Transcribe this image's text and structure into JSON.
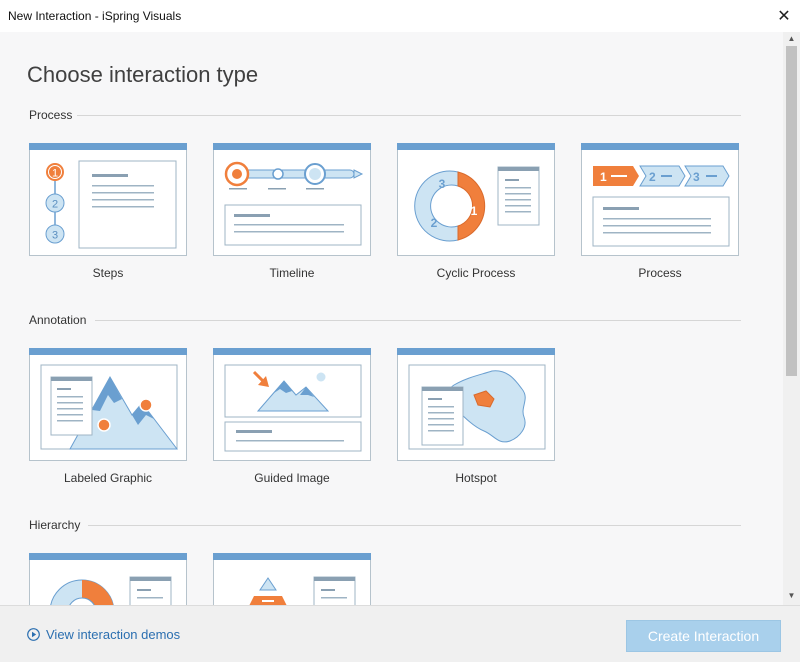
{
  "window": {
    "title": "New Interaction - iSpring Visuals",
    "close_icon": "close-icon"
  },
  "main": {
    "heading": "Choose interaction type",
    "sections": [
      {
        "label": "Process",
        "items": [
          {
            "label": "Steps"
          },
          {
            "label": "Timeline"
          },
          {
            "label": "Cyclic Process"
          },
          {
            "label": "Process"
          }
        ]
      },
      {
        "label": "Annotation",
        "items": [
          {
            "label": "Labeled Graphic"
          },
          {
            "label": "Guided Image"
          },
          {
            "label": "Hotspot"
          }
        ]
      },
      {
        "label": "Hierarchy",
        "items": []
      }
    ],
    "steps_icon": {
      "n1": "1",
      "n2": "2",
      "n3": "3"
    },
    "cyclic_icon": {
      "n1": "1",
      "n2": "2",
      "n3": "3"
    },
    "process_icon": {
      "n1": "1",
      "n2": "2",
      "n3": "3"
    }
  },
  "footer": {
    "demo_link": "View interaction demos",
    "demo_icon": "play-circle-icon",
    "create_button": "Create Interaction",
    "create_button_state": "disabled"
  },
  "colors": {
    "accent_blue": "#6a9fd0",
    "accent_orange": "#f07f3c",
    "light_blue": "#cde4f3",
    "link": "#2b6fb0",
    "button_disabled": "#a9d0ec"
  }
}
